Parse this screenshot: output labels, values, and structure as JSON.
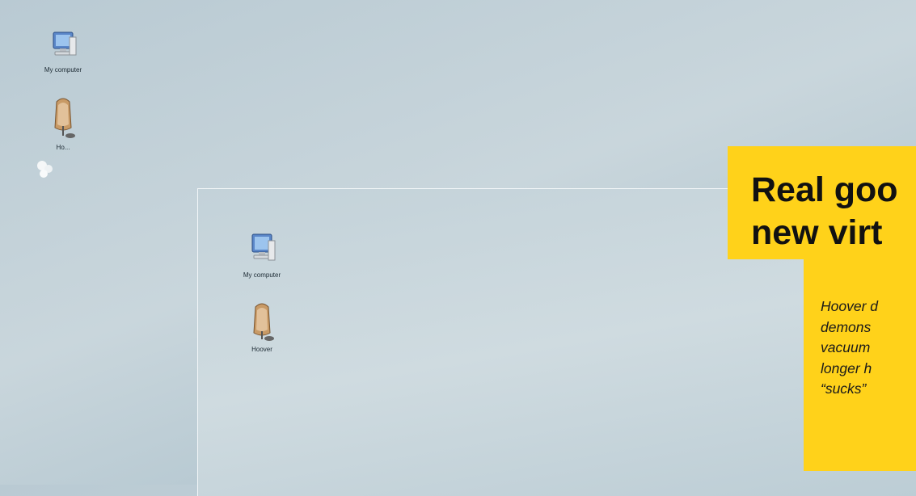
{
  "desktop": {
    "icons": [
      {
        "label": "My computer"
      },
      {
        "label": "Ho..."
      }
    ]
  },
  "inner_desktop": {
    "icons": [
      {
        "label": "My computer"
      },
      {
        "label": "Hoover"
      }
    ]
  },
  "headline": {
    "line1": "Real goo",
    "line2": "new virt"
  },
  "caption": {
    "line1": "Hoover d",
    "line2": "demons",
    "line3": "vacuum",
    "line4": "longer h",
    "line5": "“sucks”"
  },
  "colors": {
    "accent_yellow": "#ffd21a",
    "desktop_bg": "#c3d2d9"
  }
}
